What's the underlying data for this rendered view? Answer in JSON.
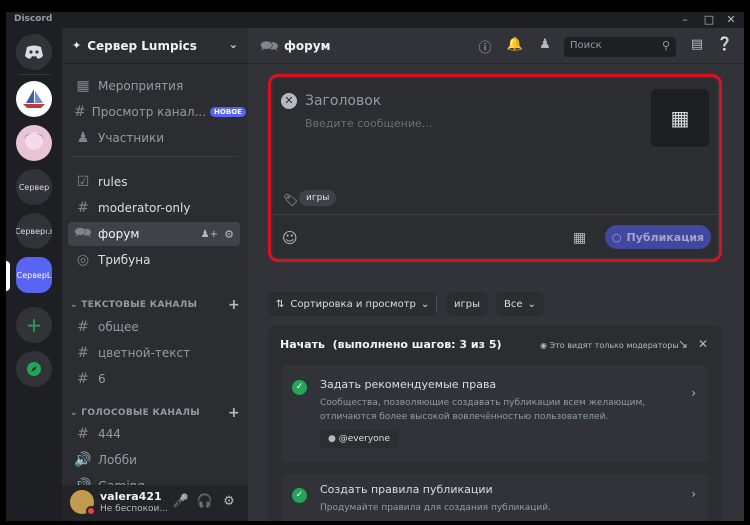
{
  "window": {
    "app_name": "Discord"
  },
  "servers": {
    "items": [
      {
        "label": "Сервер"
      },
      {
        "label": "Серверı.r"
      },
      {
        "label": "СерверL"
      }
    ]
  },
  "guild": {
    "name": "Сервер Lumpics"
  },
  "sidebar": {
    "top_items": [
      {
        "label": "Мероприятия"
      },
      {
        "label": "Просмотр канал...",
        "badge": "НОВОЕ"
      },
      {
        "label": "Участники"
      }
    ],
    "channels": [
      {
        "label": "rules"
      },
      {
        "label": "moderator-only"
      },
      {
        "label": "форум"
      },
      {
        "label": "Трибуна"
      }
    ],
    "text_category": "ТЕКСТОВЫЕ КАНАЛЫ",
    "text_channels": [
      {
        "label": "общее"
      },
      {
        "label": "цветной-текст"
      },
      {
        "label": "6"
      }
    ],
    "voice_category": "ГОЛОСОВЫЕ КАНАЛЫ",
    "voice_channels": [
      {
        "label": "444"
      },
      {
        "label": "Лобби"
      },
      {
        "label": "Gaming"
      }
    ]
  },
  "user": {
    "name": "valera421",
    "status": "Не беспокои..."
  },
  "header": {
    "title": "форум",
    "search_placeholder": "Поиск"
  },
  "composer": {
    "title_placeholder": "Заголовок",
    "message_placeholder": "Введите сообщение...",
    "tag": "игры",
    "publish_label": "Публикация"
  },
  "filters": {
    "sort_label": "Сортировка и просмотр",
    "tag": "игры",
    "all_label": "Все"
  },
  "getting_started": {
    "title": "Начать",
    "progress": "(выполнено шагов: 3 из 5)",
    "mod_notice": "Это видят только модераторы",
    "steps": [
      {
        "title": "Задать рекомендуемые права",
        "description": "Сообщества, позволяющие создавать публикации всем желающим, отличаются более высокой вовлечённостью пользователей.",
        "role": "@everyone"
      },
      {
        "title": "Создать правила публикации",
        "description": "Продумайте правила для создания публикаций."
      }
    ]
  },
  "colors": {
    "accent": "#5865f2",
    "highlight": "#d9121f",
    "success": "#23a55a"
  }
}
